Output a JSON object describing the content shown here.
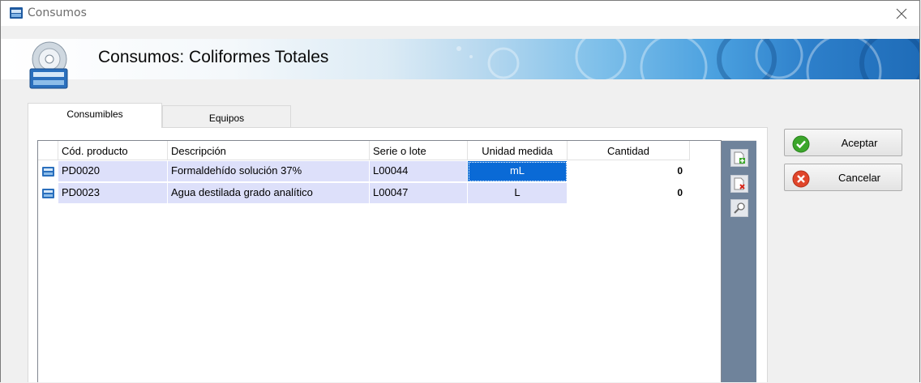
{
  "window": {
    "title": "Consumos"
  },
  "banner": {
    "title": "Consumos: Coliformes Totales"
  },
  "tabs": [
    {
      "label": "Consumibles",
      "active": true
    },
    {
      "label": "Equipos",
      "active": false
    }
  ],
  "grid": {
    "columns": [
      "Cód. producto",
      "Descripción",
      "Serie o lote",
      "Unidad medida",
      "Cantidad"
    ],
    "rows": [
      {
        "code": "PD0020",
        "description": "Formaldehído solución 37%",
        "lot": "L00044",
        "unit": "mL",
        "quantity": "0"
      },
      {
        "code": "PD0023",
        "description": "Agua destilada grado analítico",
        "lot": "L00047",
        "unit": "L",
        "quantity": "0"
      }
    ]
  },
  "toolbar": {
    "icons": [
      "add-row-icon",
      "delete-row-icon",
      "search-icon"
    ]
  },
  "buttons": {
    "accept_label": "Aceptar",
    "cancel_label": "Cancelar"
  },
  "colors": {
    "row_bg": "#dde0fa",
    "selected": "#0a6ad6",
    "toolbar": "#6f839b",
    "accept": "#3ba62b",
    "cancel": "#e0452a"
  }
}
